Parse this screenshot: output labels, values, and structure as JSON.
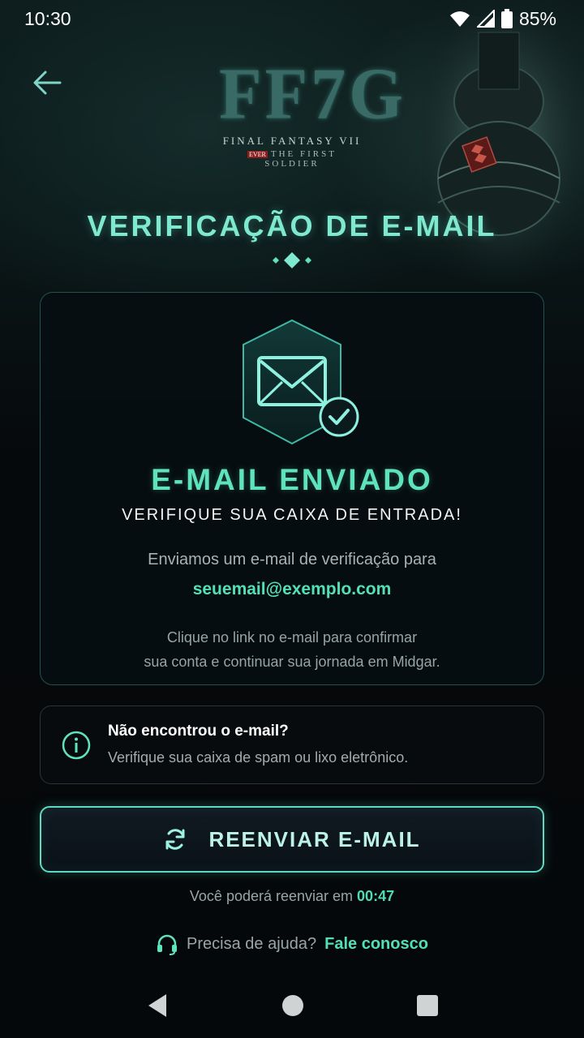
{
  "status_bar": {
    "time": "10:30",
    "battery": "85%"
  },
  "logo": {
    "mark": "FF7G",
    "line1": "FINAL FANTASY VII",
    "line2": "THE FIRST SOLDIER",
    "badge": "EVER"
  },
  "page": {
    "title": "VERIFICAÇÃO DE E-MAIL"
  },
  "card": {
    "heading": "E-MAIL ENVIADO",
    "subheading": "VERIFIQUE SUA CAIXA DE ENTRADA!",
    "sent_text": "Enviamos um e-mail de verificação para",
    "email": "seuemail@exemplo.com",
    "instructions_line1": "Clique no link no e-mail para confirmar",
    "instructions_line2": "sua conta e continuar sua jornada em Midgar."
  },
  "info": {
    "title": "Não encontrou o e-mail?",
    "text": "Verifique sua caixa de spam ou lixo eletrônico."
  },
  "resend": {
    "label": "REENVIAR E-MAIL",
    "timer_text": "Você poderá reenviar em",
    "timer_value": "00:47"
  },
  "help": {
    "text": "Precisa de ajuda?",
    "link": "Fale conosco"
  },
  "colors": {
    "accent": "#5fe3bd",
    "border": "#1f5350",
    "background": "#05090b"
  }
}
